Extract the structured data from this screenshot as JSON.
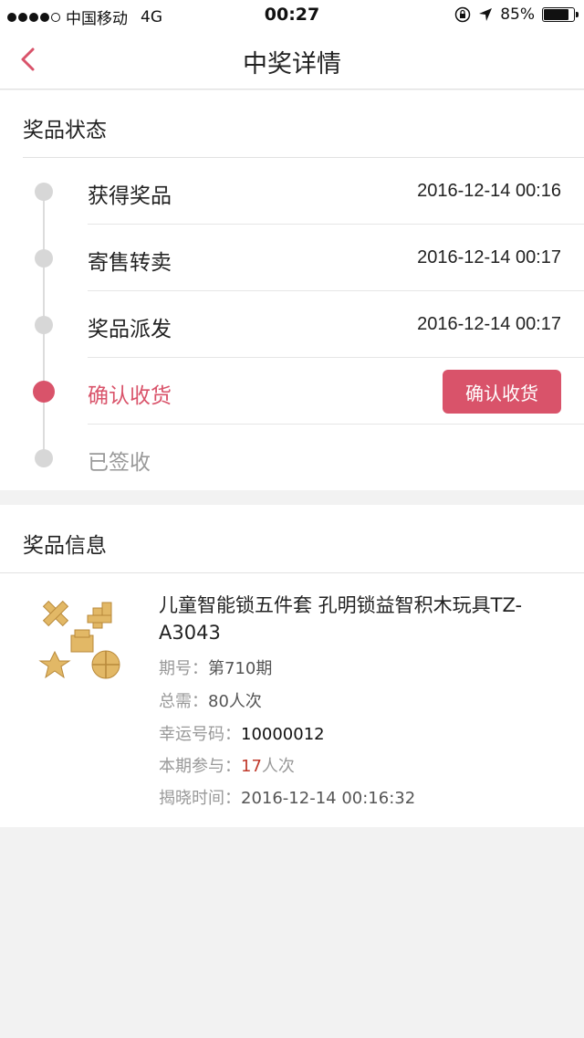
{
  "status_bar": {
    "carrier": "中国移动",
    "network": "4G",
    "time": "00:27",
    "battery": "85%",
    "battery_level": 0.85
  },
  "nav": {
    "title": "中奖详情",
    "back_icon": "chevron-left-icon",
    "accent": "#d9536a"
  },
  "prize_status": {
    "title": "奖品状态",
    "steps": [
      {
        "label": "获得奖品",
        "time": "2016-12-14 00:16"
      },
      {
        "label": "寄售转卖",
        "time": "2016-12-14 00:17"
      },
      {
        "label": "奖品派发",
        "time": "2016-12-14 00:17"
      },
      {
        "label": "确认收货",
        "button": "确认收货"
      },
      {
        "label": "已签收"
      }
    ]
  },
  "prize_info": {
    "title": "奖品信息",
    "product_name": "儿童智能锁五件套 孔明锁益智积木玩具TZ-A3043",
    "period_label": "期号：",
    "period_value": "第710期",
    "total_label": "总需：",
    "total_value": "80人次",
    "lucky_label": "幸运号码：",
    "lucky_value": "10000012",
    "participate_label": "本期参与：",
    "participate_count": "17",
    "participate_unit": "人次",
    "reveal_label": "揭晓时间：",
    "reveal_value": "2016-12-14 00:16:32"
  }
}
